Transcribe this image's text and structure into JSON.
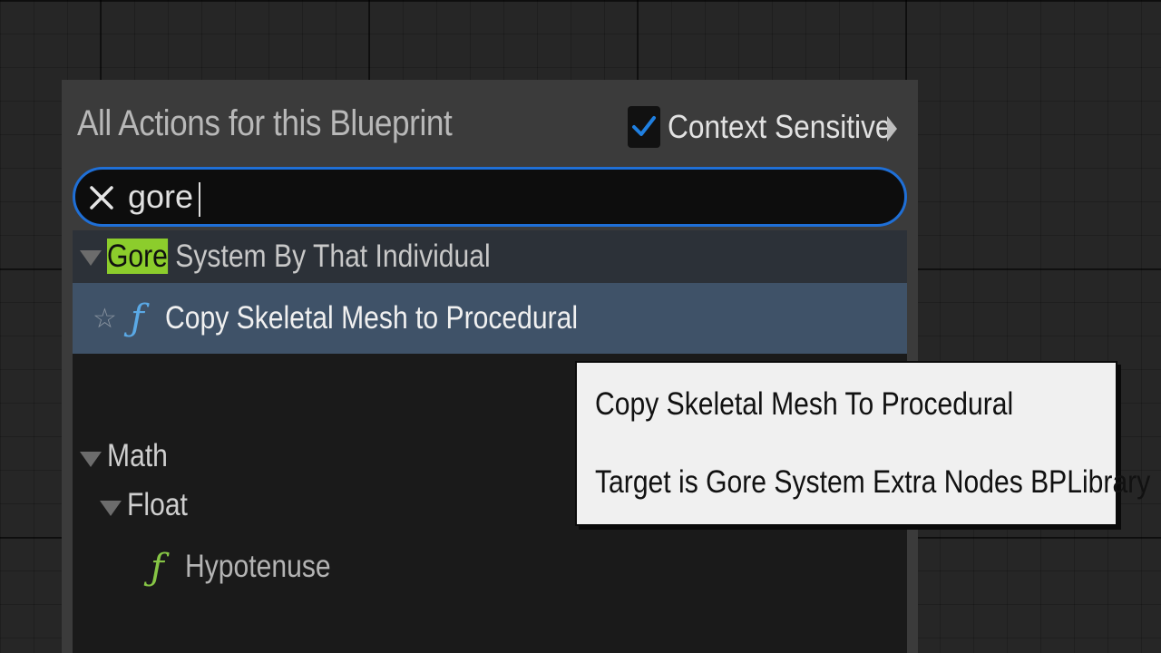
{
  "panel": {
    "title": "All Actions for this Blueprint",
    "context_sensitive": {
      "label": "Context Sensitive",
      "checked": true
    }
  },
  "search": {
    "value": "gore",
    "placeholder": ""
  },
  "results": {
    "categories": [
      {
        "highlight": "Gore",
        "label_rest": " System By That Individual",
        "expanded": true,
        "items": [
          {
            "label": "Copy Skeletal Mesh to Procedural",
            "icon": "function-icon",
            "selected": true,
            "favorite": false
          }
        ]
      },
      {
        "label": "Math",
        "expanded": true,
        "subcategories": [
          {
            "label": "Float",
            "expanded": true,
            "items": [
              {
                "label": "Hypotenuse",
                "icon": "function-icon"
              }
            ]
          }
        ]
      }
    ]
  },
  "tooltip": {
    "title": "Copy Skeletal Mesh To Procedural",
    "target": "Target is Gore System Extra Nodes BPLibrary"
  },
  "colors": {
    "accent_blue": "#1f6fd6",
    "search_highlight": "#8ccd2c",
    "selected_row": "#3f5268",
    "function_icon_blue": "#5aa9e6",
    "function_icon_green": "#86c545"
  }
}
